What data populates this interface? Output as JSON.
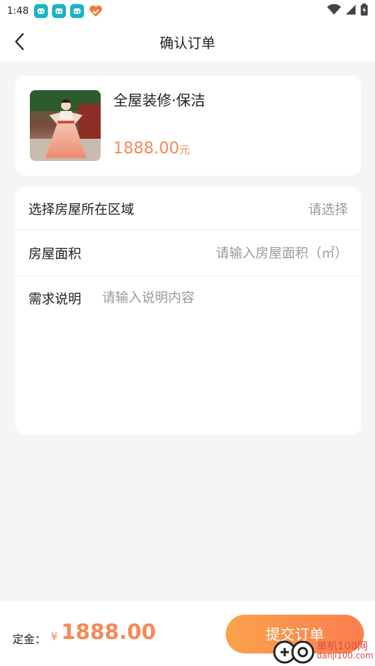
{
  "status_bar": {
    "time": "1:48"
  },
  "header": {
    "title": "确认订单"
  },
  "product": {
    "name": "全屋装修·保洁",
    "price": "1888.00",
    "price_unit": "元"
  },
  "form": {
    "region_label": "选择房屋所在区域",
    "region_value": "请选择",
    "area_label": "房屋面积",
    "area_placeholder": "请输入房屋面积（㎡）",
    "desc_label": "需求说明",
    "desc_placeholder": "请输入说明内容"
  },
  "footer": {
    "deposit_label": "定金：",
    "currency": "¥",
    "deposit_amount": "1888.00",
    "submit_label": "提交订单"
  },
  "watermark": {
    "text": "单机100网",
    "url": "danji100.com"
  },
  "colors": {
    "accent": "#f5895a",
    "button_start": "#fba24c",
    "button_end": "#fb7f4e",
    "background": "#f5f5f5"
  }
}
